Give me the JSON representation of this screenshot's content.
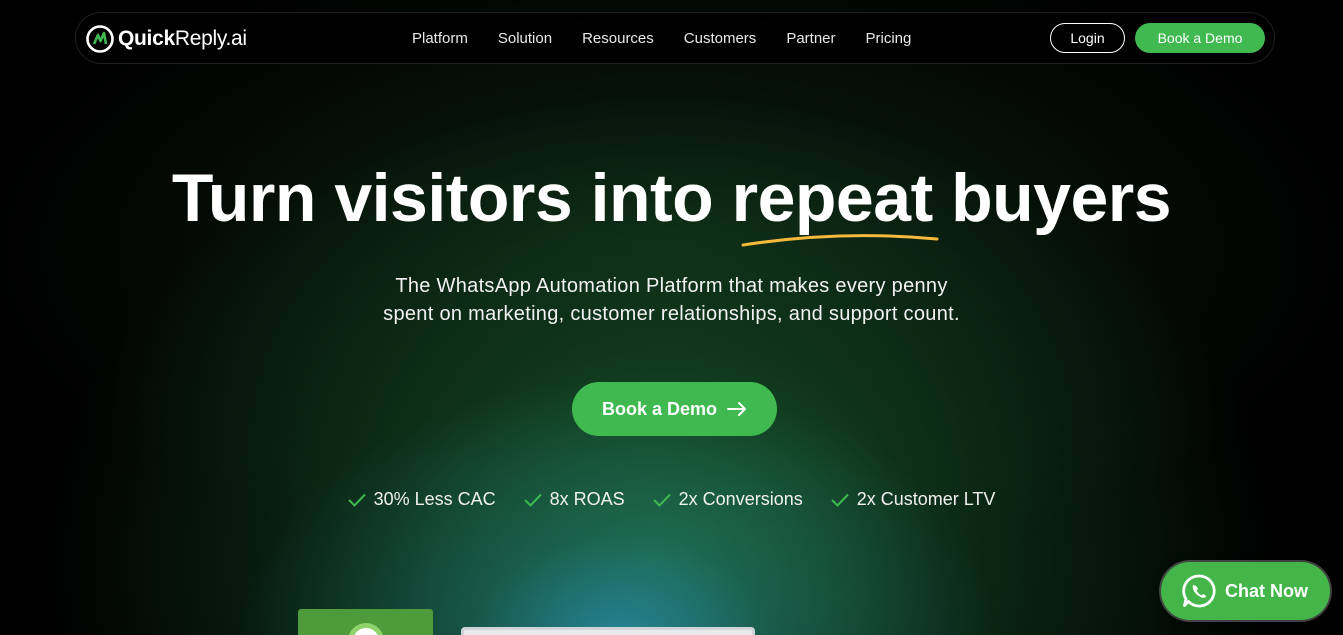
{
  "brand": {
    "name_bold": "Quick",
    "name_rest": "Reply.ai",
    "accent_color": "#3fb950"
  },
  "nav": {
    "links": [
      "Platform",
      "Solution",
      "Resources",
      "Customers",
      "Partner",
      "Pricing"
    ],
    "login_label": "Login",
    "demo_label": "Book a Demo"
  },
  "hero": {
    "headline": "Turn visitors into repeat buyers",
    "subtitle_line1": "The WhatsApp Automation Platform that makes every penny",
    "subtitle_line2": "spent on marketing, customer relationships, and support count.",
    "cta_label": "Book a Demo"
  },
  "features": [
    "30% Less CAC",
    "8x ROAS",
    "2x Conversions",
    "2x Customer LTV"
  ],
  "chat_widget": {
    "label": "Chat Now",
    "icon": "whatsapp-icon"
  },
  "colors": {
    "underline": "#f5b93b",
    "check": "#3fb950"
  }
}
